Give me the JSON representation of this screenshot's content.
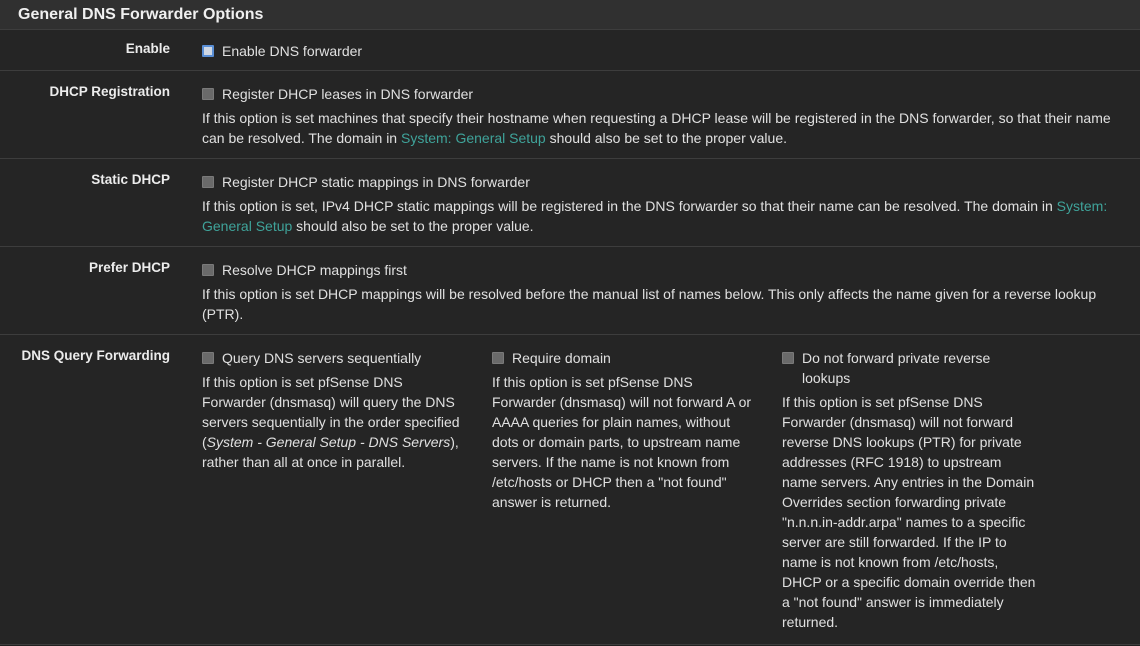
{
  "panel": {
    "title": "General DNS Forwarder Options"
  },
  "rows": {
    "enable": {
      "label": "Enable",
      "checkbox_label": "Enable DNS forwarder"
    },
    "dhcp_registration": {
      "label": "DHCP Registration",
      "checkbox_label": "Register DHCP leases in DNS forwarder",
      "help_pre": "If this option is set machines that specify their hostname when requesting a DHCP lease will be registered in the DNS forwarder, so that their name can be resolved. The domain in ",
      "help_link": "System: General Setup",
      "help_post": " should also be set to the proper value."
    },
    "static_dhcp": {
      "label": "Static DHCP",
      "checkbox_label": "Register DHCP static mappings in DNS forwarder",
      "help_pre": "If this option is set, IPv4 DHCP static mappings will be registered in the DNS forwarder so that their name can be resolved. The domain in ",
      "help_link": "System: General Setup",
      "help_post": " should also be set to the proper value."
    },
    "prefer_dhcp": {
      "label": "Prefer DHCP",
      "checkbox_label": "Resolve DHCP mappings first",
      "help": "If this option is set DHCP mappings will be resolved before the manual list of names below. This only affects the name given for a reverse lookup (PTR)."
    },
    "dns_query_forwarding": {
      "label": "DNS Query Forwarding",
      "sequential": {
        "checkbox_label": "Query DNS servers sequentially",
        "help_pre": "If this option is set pfSense DNS Forwarder (dnsmasq) will query the DNS servers sequentially in the order specified (",
        "help_em": "System - General Setup - DNS Servers",
        "help_post": "), rather than all at once in parallel."
      },
      "require_domain": {
        "checkbox_label": "Require domain",
        "help": "If this option is set pfSense DNS Forwarder (dnsmasq) will not forward A or AAAA queries for plain names, without dots or domain parts, to upstream name servers. If the name is not known from /etc/hosts or DHCP then a \"not found\" answer is returned."
      },
      "no_private_reverse": {
        "checkbox_label": "Do not forward private reverse lookups",
        "help": "If this option is set pfSense DNS Forwarder (dnsmasq) will not forward reverse DNS lookups (PTR) for private addresses (RFC 1918) to upstream name servers. Any entries in the Domain Overrides section forwarding private \"n.n.n.in-addr.arpa\" names to a specific server are still forwarded. If the IP to name is not known from /etc/hosts, DHCP or a specific domain override then a \"not found\" answer is immediately returned."
      }
    }
  }
}
